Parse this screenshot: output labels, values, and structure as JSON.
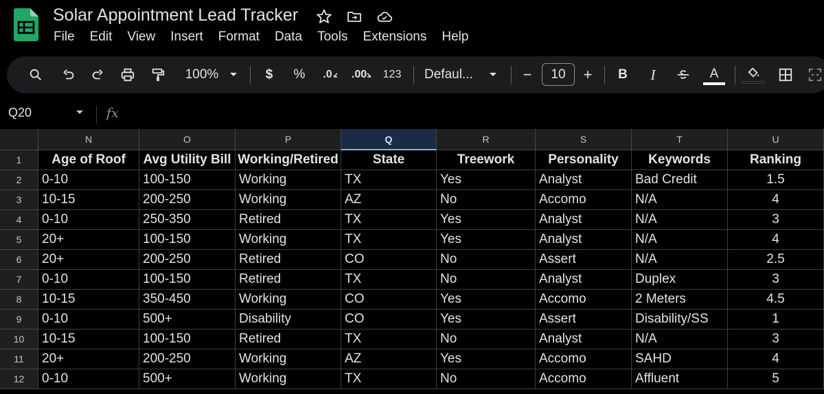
{
  "app": {
    "title": "Solar Appointment Lead Tracker",
    "menus": [
      "File",
      "Edit",
      "View",
      "Insert",
      "Format",
      "Data",
      "Tools",
      "Extensions",
      "Help"
    ],
    "title_icons": [
      "star-icon",
      "move-to-folder-icon",
      "cloud-status-icon"
    ]
  },
  "toolbar": {
    "zoom": "100%",
    "currency": "$",
    "percent": "%",
    "decrease_decimal": ".0",
    "increase_decimal": ".00",
    "more_formats": "123",
    "font_family": "Defaul...",
    "font_size": "10",
    "bold": "B",
    "italic": "I",
    "text_color_glyph": "A",
    "minus": "−",
    "plus": "+"
  },
  "formula_bar": {
    "name_box": "Q20",
    "fx": "fx",
    "value": ""
  },
  "grid": {
    "selected_column": "Q",
    "columns": [
      "N",
      "O",
      "P",
      "Q",
      "R",
      "S",
      "T",
      "U"
    ],
    "row_numbers": [
      "1",
      "2",
      "3",
      "4",
      "5",
      "6",
      "7",
      "8",
      "9",
      "10",
      "11",
      "12"
    ],
    "header_row": [
      "Age of Roof",
      "Avg Utility Bill",
      "Working/Retired",
      "State",
      "Treework",
      "Personality",
      "Keywords",
      "Ranking"
    ],
    "rows": [
      [
        "0-10",
        "100-150",
        "Working",
        "TX",
        "Yes",
        "Analyst",
        "Bad Credit",
        "1.5"
      ],
      [
        "10-15",
        "200-250",
        "Working",
        "AZ",
        "No",
        "Accomo",
        "N/A",
        "4"
      ],
      [
        "0-10",
        "250-350",
        "Retired",
        "TX",
        "Yes",
        "Analyst",
        "N/A",
        "3"
      ],
      [
        "20+",
        "100-150",
        "Working",
        "TX",
        "Yes",
        "Analyst",
        "N/A",
        "4"
      ],
      [
        "20+",
        "200-250",
        "Retired",
        "CO",
        "No",
        "Assert",
        "N/A",
        "2.5"
      ],
      [
        "0-10",
        "100-150",
        "Retired",
        "TX",
        "No",
        "Analyst",
        "Duplex",
        "3"
      ],
      [
        "10-15",
        "350-450",
        "Working",
        "CO",
        "Yes",
        "Accomo",
        "2 Meters",
        "4.5"
      ],
      [
        "0-10",
        "500+",
        "Disability",
        "CO",
        "Yes",
        "Assert",
        "Disability/SS",
        "1"
      ],
      [
        "10-15",
        "100-150",
        "Retired",
        "TX",
        "No",
        "Analyst",
        "N/A",
        "3"
      ],
      [
        "20+",
        "200-250",
        "Working",
        "AZ",
        "Yes",
        "Accomo",
        "SAHD",
        "4"
      ],
      [
        "0-10",
        "500+",
        "Working",
        "TX",
        "No",
        "Accomo",
        "Affluent",
        "5"
      ]
    ]
  },
  "colors": {
    "background": "#000000",
    "toolbar": "#1b1c1e",
    "header_bg": "#1e1f20",
    "selected_column_bg": "#1b2a47",
    "sheets_green": "#0f9d58",
    "text": "#e3e3e3"
  }
}
